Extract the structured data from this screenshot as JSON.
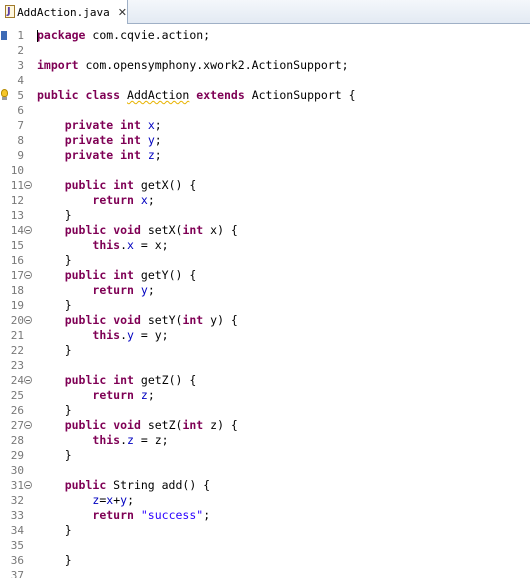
{
  "tab": {
    "label": "AddAction.java",
    "close_glyph": "✕",
    "icon": "java-file-icon"
  },
  "editor": {
    "lines": [
      {
        "n": "1",
        "tokens": [
          {
            "t": "package",
            "c": "kw"
          },
          {
            "t": " com.cqvie.action;",
            "c": "p"
          }
        ]
      },
      {
        "n": "2",
        "tokens": []
      },
      {
        "n": "3",
        "tokens": [
          {
            "t": "import",
            "c": "kw"
          },
          {
            "t": " com.opensymphony.xwork2.ActionSupport;",
            "c": "p"
          }
        ]
      },
      {
        "n": "4",
        "tokens": []
      },
      {
        "n": "5",
        "tokens": [
          {
            "t": "public",
            "c": "kw"
          },
          {
            "t": " ",
            "c": "p"
          },
          {
            "t": "class",
            "c": "kw"
          },
          {
            "t": " ",
            "c": "p"
          },
          {
            "t": "AddAction",
            "c": "squig"
          },
          {
            "t": " ",
            "c": "p"
          },
          {
            "t": "extends",
            "c": "kw"
          },
          {
            "t": " ActionSupport {",
            "c": "p"
          }
        ]
      },
      {
        "n": "6",
        "tokens": []
      },
      {
        "n": "7",
        "tokens": [
          {
            "t": "    ",
            "c": "p"
          },
          {
            "t": "private",
            "c": "kw"
          },
          {
            "t": " ",
            "c": "p"
          },
          {
            "t": "int",
            "c": "kw"
          },
          {
            "t": " ",
            "c": "p"
          },
          {
            "t": "x",
            "c": "fld"
          },
          {
            "t": ";",
            "c": "p"
          }
        ]
      },
      {
        "n": "8",
        "tokens": [
          {
            "t": "    ",
            "c": "p"
          },
          {
            "t": "private",
            "c": "kw"
          },
          {
            "t": " ",
            "c": "p"
          },
          {
            "t": "int",
            "c": "kw"
          },
          {
            "t": " ",
            "c": "p"
          },
          {
            "t": "y",
            "c": "fld"
          },
          {
            "t": ";",
            "c": "p"
          }
        ]
      },
      {
        "n": "9",
        "tokens": [
          {
            "t": "    ",
            "c": "p"
          },
          {
            "t": "private",
            "c": "kw"
          },
          {
            "t": " ",
            "c": "p"
          },
          {
            "t": "int",
            "c": "kw"
          },
          {
            "t": " ",
            "c": "p"
          },
          {
            "t": "z",
            "c": "fld"
          },
          {
            "t": ";",
            "c": "p"
          }
        ]
      },
      {
        "n": "10",
        "tokens": []
      },
      {
        "n": "11",
        "fold": true,
        "tokens": [
          {
            "t": "    ",
            "c": "p"
          },
          {
            "t": "public",
            "c": "kw"
          },
          {
            "t": " ",
            "c": "p"
          },
          {
            "t": "int",
            "c": "kw"
          },
          {
            "t": " getX() {",
            "c": "p"
          }
        ]
      },
      {
        "n": "12",
        "tokens": [
          {
            "t": "        ",
            "c": "p"
          },
          {
            "t": "return",
            "c": "kw"
          },
          {
            "t": " ",
            "c": "p"
          },
          {
            "t": "x",
            "c": "fld"
          },
          {
            "t": ";",
            "c": "p"
          }
        ]
      },
      {
        "n": "13",
        "tokens": [
          {
            "t": "    }",
            "c": "p"
          }
        ]
      },
      {
        "n": "14",
        "fold": true,
        "tokens": [
          {
            "t": "    ",
            "c": "p"
          },
          {
            "t": "public",
            "c": "kw"
          },
          {
            "t": " ",
            "c": "p"
          },
          {
            "t": "void",
            "c": "kw"
          },
          {
            "t": " setX(",
            "c": "p"
          },
          {
            "t": "int",
            "c": "kw"
          },
          {
            "t": " x) {",
            "c": "p"
          }
        ]
      },
      {
        "n": "15",
        "tokens": [
          {
            "t": "        ",
            "c": "p"
          },
          {
            "t": "this",
            "c": "kw"
          },
          {
            "t": ".",
            "c": "p"
          },
          {
            "t": "x",
            "c": "fld"
          },
          {
            "t": " = x;",
            "c": "p"
          }
        ]
      },
      {
        "n": "16",
        "tokens": [
          {
            "t": "    }",
            "c": "p"
          }
        ]
      },
      {
        "n": "17",
        "fold": true,
        "tokens": [
          {
            "t": "    ",
            "c": "p"
          },
          {
            "t": "public",
            "c": "kw"
          },
          {
            "t": " ",
            "c": "p"
          },
          {
            "t": "int",
            "c": "kw"
          },
          {
            "t": " getY() {",
            "c": "p"
          }
        ]
      },
      {
        "n": "18",
        "tokens": [
          {
            "t": "        ",
            "c": "p"
          },
          {
            "t": "return",
            "c": "kw"
          },
          {
            "t": " ",
            "c": "p"
          },
          {
            "t": "y",
            "c": "fld"
          },
          {
            "t": ";",
            "c": "p"
          }
        ]
      },
      {
        "n": "19",
        "tokens": [
          {
            "t": "    }",
            "c": "p"
          }
        ]
      },
      {
        "n": "20",
        "fold": true,
        "tokens": [
          {
            "t": "    ",
            "c": "p"
          },
          {
            "t": "public",
            "c": "kw"
          },
          {
            "t": " ",
            "c": "p"
          },
          {
            "t": "void",
            "c": "kw"
          },
          {
            "t": " setY(",
            "c": "p"
          },
          {
            "t": "int",
            "c": "kw"
          },
          {
            "t": " y) {",
            "c": "p"
          }
        ]
      },
      {
        "n": "21",
        "tokens": [
          {
            "t": "        ",
            "c": "p"
          },
          {
            "t": "this",
            "c": "kw"
          },
          {
            "t": ".",
            "c": "p"
          },
          {
            "t": "y",
            "c": "fld"
          },
          {
            "t": " = y;",
            "c": "p"
          }
        ]
      },
      {
        "n": "22",
        "tokens": [
          {
            "t": "    }",
            "c": "p"
          }
        ]
      },
      {
        "n": "23",
        "tokens": []
      },
      {
        "n": "24",
        "fold": true,
        "tokens": [
          {
            "t": "    ",
            "c": "p"
          },
          {
            "t": "public",
            "c": "kw"
          },
          {
            "t": " ",
            "c": "p"
          },
          {
            "t": "int",
            "c": "kw"
          },
          {
            "t": " getZ() {",
            "c": "p"
          }
        ]
      },
      {
        "n": "25",
        "tokens": [
          {
            "t": "        ",
            "c": "p"
          },
          {
            "t": "return",
            "c": "kw"
          },
          {
            "t": " ",
            "c": "p"
          },
          {
            "t": "z",
            "c": "fld"
          },
          {
            "t": ";",
            "c": "p"
          }
        ]
      },
      {
        "n": "26",
        "tokens": [
          {
            "t": "    }",
            "c": "p"
          }
        ]
      },
      {
        "n": "27",
        "fold": true,
        "tokens": [
          {
            "t": "    ",
            "c": "p"
          },
          {
            "t": "public",
            "c": "kw"
          },
          {
            "t": " ",
            "c": "p"
          },
          {
            "t": "void",
            "c": "kw"
          },
          {
            "t": " setZ(",
            "c": "p"
          },
          {
            "t": "int",
            "c": "kw"
          },
          {
            "t": " z) {",
            "c": "p"
          }
        ]
      },
      {
        "n": "28",
        "tokens": [
          {
            "t": "        ",
            "c": "p"
          },
          {
            "t": "this",
            "c": "kw"
          },
          {
            "t": ".",
            "c": "p"
          },
          {
            "t": "z",
            "c": "fld"
          },
          {
            "t": " = z;",
            "c": "p"
          }
        ]
      },
      {
        "n": "29",
        "tokens": [
          {
            "t": "    }",
            "c": "p"
          }
        ]
      },
      {
        "n": "30",
        "tokens": []
      },
      {
        "n": "31",
        "fold": true,
        "tokens": [
          {
            "t": "    ",
            "c": "p"
          },
          {
            "t": "public",
            "c": "kw"
          },
          {
            "t": " String add() {",
            "c": "p"
          }
        ]
      },
      {
        "n": "32",
        "tokens": [
          {
            "t": "        ",
            "c": "p"
          },
          {
            "t": "z",
            "c": "fld"
          },
          {
            "t": "=",
            "c": "p"
          },
          {
            "t": "x",
            "c": "fld"
          },
          {
            "t": "+",
            "c": "p"
          },
          {
            "t": "y",
            "c": "fld"
          },
          {
            "t": ";",
            "c": "p"
          }
        ]
      },
      {
        "n": "33",
        "tokens": [
          {
            "t": "        ",
            "c": "p"
          },
          {
            "t": "return",
            "c": "kw"
          },
          {
            "t": " ",
            "c": "p"
          },
          {
            "t": "\"success\"",
            "c": "str"
          },
          {
            "t": ";",
            "c": "p"
          }
        ]
      },
      {
        "n": "34",
        "tokens": [
          {
            "t": "    }",
            "c": "p"
          }
        ]
      },
      {
        "n": "35",
        "tokens": []
      },
      {
        "n": "36",
        "tokens": [
          {
            "t": "    }",
            "c": "p"
          }
        ]
      },
      {
        "n": "37",
        "tokens": []
      }
    ],
    "warning_line": "5",
    "bookmark_line": "1",
    "colors": {
      "keyword": "#7f0055",
      "field": "#0000c0",
      "string": "#2a00ff",
      "line_number": "#787878"
    }
  }
}
